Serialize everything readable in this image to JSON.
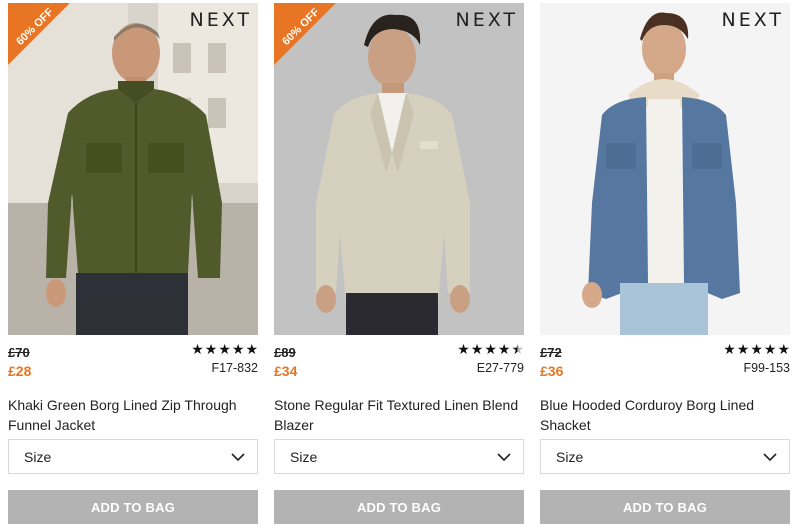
{
  "accent_color": "#e87524",
  "button_color": "#b3b3b3",
  "products": [
    {
      "brand": "NEXT",
      "badge": "60% OFF",
      "old_price": "£70",
      "new_price": "£28",
      "rating_stars": 5,
      "code": "F17-832",
      "title": "Khaki Green Borg Lined Zip Through Funnel Jacket",
      "size_label": "Size",
      "add_label": "ADD TO BAG"
    },
    {
      "brand": "NEXT",
      "badge": "60% OFF",
      "old_price": "£89",
      "new_price": "£34",
      "rating_stars": 4.5,
      "code": "E27-779",
      "title": "Stone Regular Fit Textured Linen Blend Blazer",
      "size_label": "Size",
      "add_label": "ADD TO BAG"
    },
    {
      "brand": "NEXT",
      "badge": "",
      "old_price": "£72",
      "new_price": "£36",
      "rating_stars": 5,
      "code": "F99-153",
      "title": "Blue Hooded Corduroy Borg Lined Shacket",
      "size_label": "Size",
      "add_label": "ADD TO BAG"
    }
  ]
}
